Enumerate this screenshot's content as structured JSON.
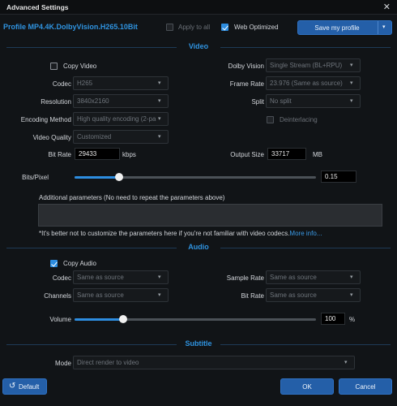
{
  "window": {
    "title": "Advanced Settings",
    "close_glyph": "✕"
  },
  "profile": {
    "label": "Profile",
    "name": "MP4.4K.DolbyVision.H265.10Bit"
  },
  "options": {
    "apply_all": "Apply to all",
    "web_optimized": "Web Optimized",
    "save_profile": "Save my profile",
    "dropdown_glyph": "▾"
  },
  "video": {
    "section": "Video",
    "copy_video": "Copy Video",
    "codec_label": "Codec",
    "codec": "H265",
    "resolution_label": "Resolution",
    "resolution": "3840x2160",
    "encoding_label": "Encoding Method",
    "encoding": "High quality encoding (2-pa",
    "quality_label": "Video Quality",
    "quality": "Customized",
    "dolby_label": "Dolby Vision",
    "dolby": "Single Stream (BL+RPU)",
    "framerate_label": "Frame Rate",
    "framerate": "23.976 (Same as source)",
    "split_label": "Split",
    "split": "No split",
    "deinterlacing": "Deinterlacing",
    "bitrate_label": "Bit Rate",
    "bitrate": "29433",
    "bitrate_unit": "kbps",
    "output_label": "Output Size",
    "output": "33717",
    "output_unit": "MB",
    "bpp_label": "Bits/Pixel",
    "bpp": "0.15",
    "bpp_fraction": 0.185,
    "params_label": "Additional parameters (No need to repeat the parameters above)",
    "warning": "*It's better not to customize the parameters here if you're not familiar with video codecs.",
    "more_info": "More info..."
  },
  "audio": {
    "section": "Audio",
    "copy_audio": "Copy Audio",
    "codec_label": "Codec",
    "codec": "Same as source",
    "channels_label": "Channels",
    "channels": "Same as source",
    "samplerate_label": "Sample Rate",
    "samplerate": "Same as source",
    "bitrate_label": "Bit Rate",
    "bitrate": "Same as source",
    "volume_label": "Volume",
    "volume": "100",
    "volume_unit": "%",
    "volume_fraction": 0.2
  },
  "subtitle": {
    "section": "Subtitle",
    "mode_label": "Mode",
    "mode": "Direct render to video"
  },
  "footer": {
    "default": "Default",
    "default_glyph": "↺",
    "ok": "OK",
    "cancel": "Cancel"
  },
  "colors": {
    "accent": "#2d8de0",
    "background": "#111417",
    "button": "#245fa8"
  },
  "arrow_glyph": "▾"
}
